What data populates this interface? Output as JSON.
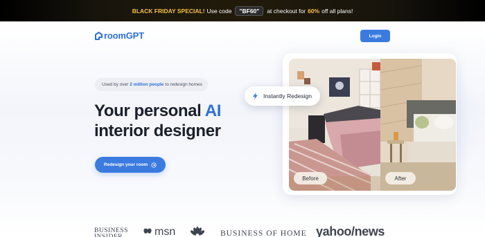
{
  "banner": {
    "label": "BLACK FRIDAY SPECIAL!",
    "text_before_code": "Use code",
    "code": "\"BF60\"",
    "text_after_code": "at checkout for",
    "discount": "60%",
    "text_end": "off all plans!"
  },
  "header": {
    "logo_text": "roomGPT",
    "login_label": "Login"
  },
  "hero": {
    "pill_prefix": "Used by over",
    "pill_highlight": "2 million people",
    "pill_suffix": "to redesign homes",
    "headline_line1_a": "Your personal",
    "headline_line1_b": "AI",
    "headline_line2": "interior designer",
    "cta_label": "Redesign your room"
  },
  "preview": {
    "chip_label": "Instantly Redesign",
    "before_label": "Before",
    "after_label": "After"
  },
  "press_logos": {
    "business_insider": "BUSINESS INSIDER",
    "msn": "msn",
    "business_of_home": "BUSINESS OF HOME",
    "yahoo_news": "yahoo/news"
  },
  "colors": {
    "accent": "#3b7be0",
    "banner_highlight": "#f5c14a"
  },
  "icons": [
    "logo-icon",
    "arrow-right-icon",
    "lightning-icon",
    "butterfly-icon",
    "peacock-icon"
  ]
}
